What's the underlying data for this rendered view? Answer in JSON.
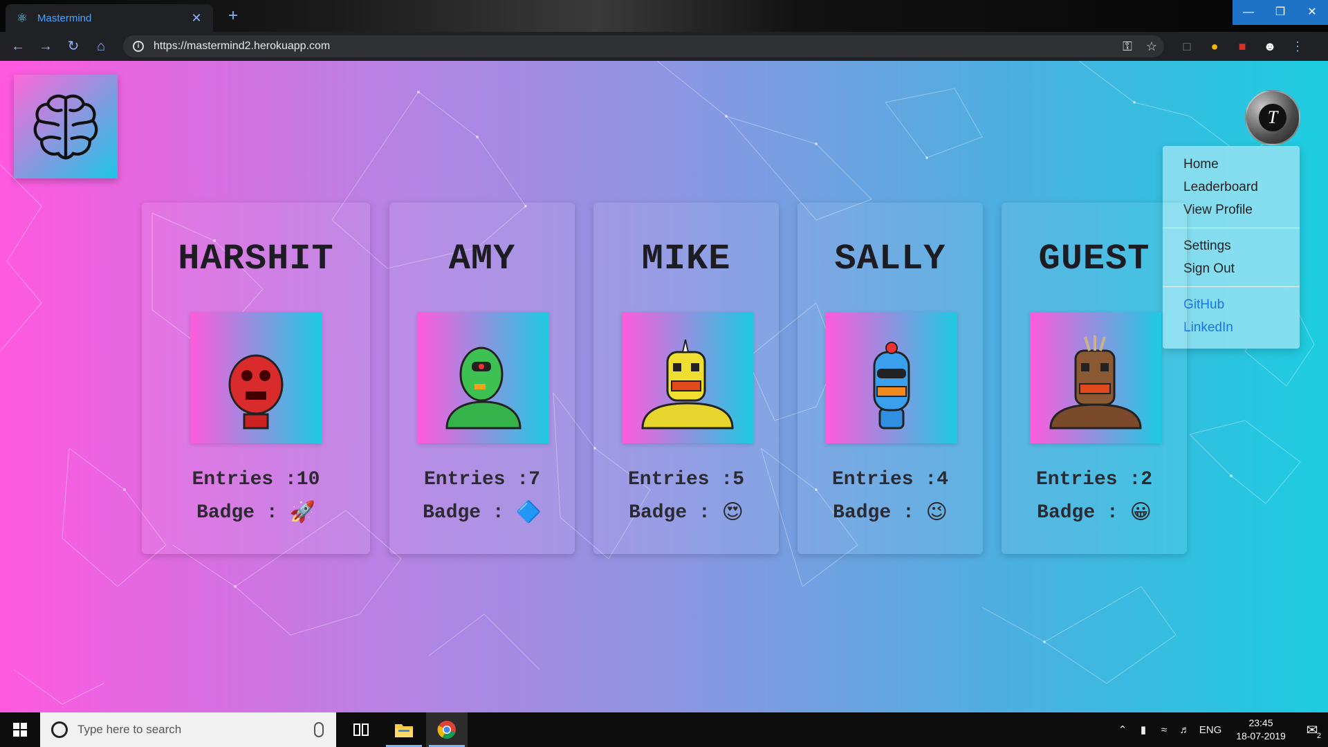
{
  "browser": {
    "tab_title": "Mastermind",
    "url": "https://mastermind2.herokuapp.com",
    "close_symbol": "✕",
    "newtab_symbol": "+"
  },
  "header": {
    "avatar_initial": "T"
  },
  "menu": {
    "items": [
      "Home",
      "Leaderboard",
      "View Profile"
    ],
    "account": [
      "Settings",
      "Sign Out"
    ],
    "links": [
      "GitHub",
      "LinkedIn"
    ]
  },
  "leaderboard": [
    {
      "name": "HARSHIT",
      "entries": "Entries :10",
      "badge_label": "Badge :",
      "badge_icon": "🚀",
      "robot_color": "#d92b2b"
    },
    {
      "name": "AMY",
      "entries": "Entries :7",
      "badge_label": "Badge :",
      "badge_icon": "🔷",
      "robot_color": "#35b34a"
    },
    {
      "name": "MIKE",
      "entries": "Entries :5",
      "badge_label": "Badge :",
      "badge_icon": "😍",
      "robot_color": "#e6d52c"
    },
    {
      "name": "SALLY",
      "entries": "Entries :4",
      "badge_label": "Badge :",
      "badge_icon": "😉",
      "robot_color": "#2f8fe0"
    },
    {
      "name": "GUEST",
      "entries": "Entries :2",
      "badge_label": "Badge :",
      "badge_icon": "😀",
      "robot_color": "#7a4a2a"
    }
  ],
  "taskbar": {
    "search_placeholder": "Type here to search",
    "language": "ENG",
    "time": "23:45",
    "date": "18-07-2019",
    "notification_count": "2"
  },
  "colors": {
    "page_gradient_start": "#ff59e0",
    "page_gradient_end": "#1ccde0",
    "link": "#1a73e8"
  }
}
